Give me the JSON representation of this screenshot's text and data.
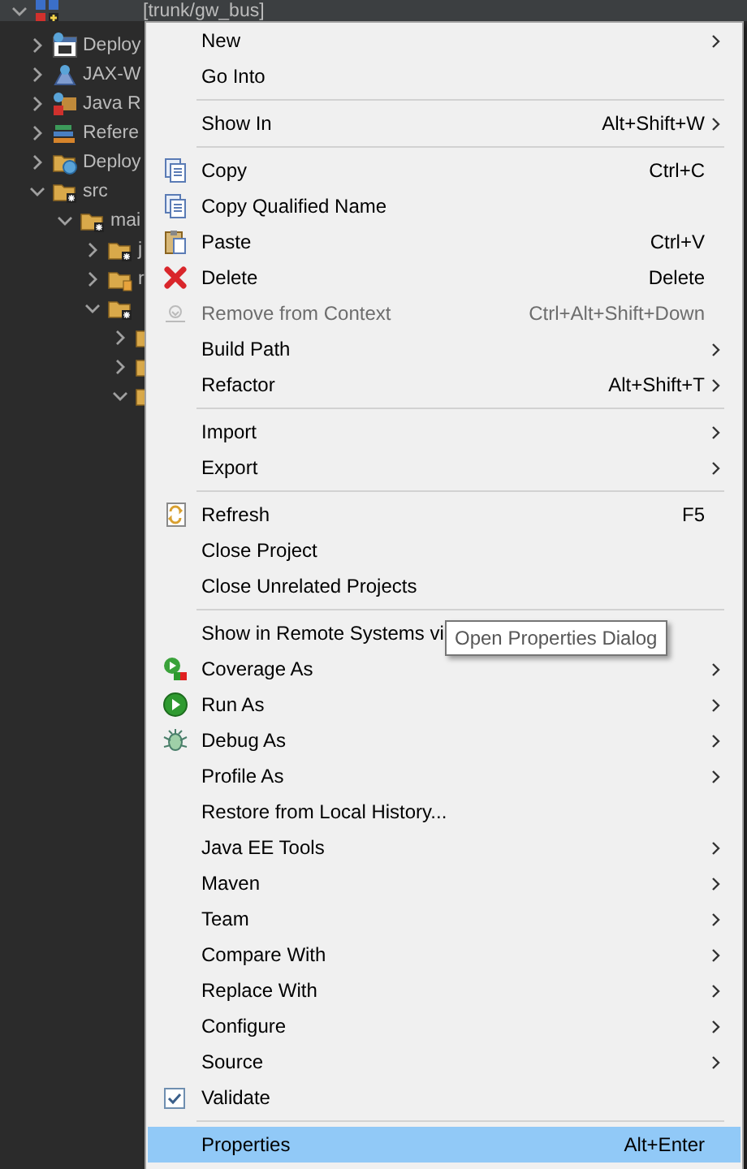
{
  "tree": {
    "items": [
      {
        "label": "[trunk/gw_bus]",
        "kind": "project",
        "expanded": true,
        "selected": true,
        "children": [
          {
            "label": "Deploy",
            "kind": "descriptor",
            "expanded": false,
            "selected": false
          },
          {
            "label": "JAX-W",
            "kind": "service",
            "expanded": false,
            "selected": false
          },
          {
            "label": "Java R",
            "kind": "resources",
            "expanded": false,
            "selected": false
          },
          {
            "label": "Refere",
            "kind": "library",
            "expanded": false,
            "selected": false
          },
          {
            "label": "Deploy",
            "kind": "deployed",
            "expanded": false,
            "selected": false
          },
          {
            "label": "src",
            "kind": "source-folder",
            "expanded": true,
            "selected": false,
            "children": [
              {
                "label": "mai",
                "kind": "source-folder",
                "expanded": true,
                "selected": false,
                "children": [
                  {
                    "label": "j",
                    "kind": "source-folder",
                    "expanded": false,
                    "selected": false
                  },
                  {
                    "label": "r",
                    "kind": "resource-folder",
                    "expanded": false,
                    "selected": false
                  },
                  {
                    "kind": "source-folder",
                    "expanded": true,
                    "selected": false,
                    "children": [
                      {
                        "kind": "folder",
                        "expanded": false,
                        "selected": false
                      },
                      {
                        "kind": "folder",
                        "expanded": false,
                        "selected": false
                      },
                      {
                        "kind": "folder",
                        "expanded": true,
                        "selected": false
                      }
                    ]
                  }
                ]
              }
            ]
          }
        ]
      }
    ]
  },
  "context_menu": {
    "items": [
      {
        "kind": "item",
        "label": "New",
        "submenu": true,
        "disabled": false,
        "selected": false
      },
      {
        "kind": "item",
        "label": "Go Into",
        "submenu": false,
        "disabled": false,
        "selected": false
      },
      {
        "kind": "separator"
      },
      {
        "kind": "item",
        "label": "Show In",
        "shortcut": "Alt+Shift+W",
        "submenu": true,
        "disabled": false,
        "selected": false
      },
      {
        "kind": "separator"
      },
      {
        "kind": "item",
        "label": "Copy",
        "shortcut": "Ctrl+C",
        "submenu": false,
        "disabled": false,
        "selected": false
      },
      {
        "kind": "item",
        "label": "Copy Qualified Name",
        "submenu": false,
        "disabled": false,
        "selected": false
      },
      {
        "kind": "item",
        "label": "Paste",
        "shortcut": "Ctrl+V",
        "submenu": false,
        "disabled": false,
        "selected": false
      },
      {
        "kind": "item",
        "label": "Delete",
        "shortcut": "Delete",
        "submenu": false,
        "disabled": false,
        "selected": false
      },
      {
        "kind": "item",
        "label": "Remove from Context",
        "shortcut": "Ctrl+Alt+Shift+Down",
        "submenu": false,
        "disabled": true,
        "selected": false
      },
      {
        "kind": "item",
        "label": "Build Path",
        "submenu": true,
        "disabled": false,
        "selected": false
      },
      {
        "kind": "item",
        "label": "Refactor",
        "shortcut": "Alt+Shift+T",
        "submenu": true,
        "disabled": false,
        "selected": false
      },
      {
        "kind": "separator"
      },
      {
        "kind": "item",
        "label": "Import",
        "submenu": true,
        "disabled": false,
        "selected": false
      },
      {
        "kind": "item",
        "label": "Export",
        "submenu": true,
        "disabled": false,
        "selected": false
      },
      {
        "kind": "separator"
      },
      {
        "kind": "item",
        "label": "Refresh",
        "shortcut": "F5",
        "submenu": false,
        "disabled": false,
        "selected": false
      },
      {
        "kind": "item",
        "label": "Close Project",
        "submenu": false,
        "disabled": false,
        "selected": false
      },
      {
        "kind": "item",
        "label": "Close Unrelated Projects",
        "submenu": false,
        "disabled": false,
        "selected": false
      },
      {
        "kind": "separator"
      },
      {
        "kind": "item",
        "label": "Show in Remote Systems vi",
        "submenu": false,
        "disabled": false,
        "selected": false
      },
      {
        "kind": "item",
        "label": "Coverage As",
        "submenu": true,
        "disabled": false,
        "selected": false
      },
      {
        "kind": "item",
        "label": "Run As",
        "submenu": true,
        "disabled": false,
        "selected": false
      },
      {
        "kind": "item",
        "label": "Debug As",
        "submenu": true,
        "disabled": false,
        "selected": false
      },
      {
        "kind": "item",
        "label": "Profile As",
        "submenu": true,
        "disabled": false,
        "selected": false
      },
      {
        "kind": "item",
        "label": "Restore from Local History...",
        "submenu": false,
        "disabled": false,
        "selected": false
      },
      {
        "kind": "item",
        "label": "Java EE Tools",
        "submenu": true,
        "disabled": false,
        "selected": false
      },
      {
        "kind": "item",
        "label": "Maven",
        "submenu": true,
        "disabled": false,
        "selected": false
      },
      {
        "kind": "item",
        "label": "Team",
        "submenu": true,
        "disabled": false,
        "selected": false
      },
      {
        "kind": "item",
        "label": "Compare With",
        "submenu": true,
        "disabled": false,
        "selected": false
      },
      {
        "kind": "item",
        "label": "Replace With",
        "submenu": true,
        "disabled": false,
        "selected": false
      },
      {
        "kind": "item",
        "label": "Configure",
        "submenu": true,
        "disabled": false,
        "selected": false
      },
      {
        "kind": "item",
        "label": "Source",
        "submenu": true,
        "disabled": false,
        "selected": false
      },
      {
        "kind": "check",
        "label": "Validate",
        "checked": true,
        "submenu": false,
        "disabled": false,
        "selected": false
      },
      {
        "kind": "separator"
      },
      {
        "kind": "item",
        "label": "Properties",
        "shortcut": "Alt+Enter",
        "submenu": false,
        "disabled": false,
        "selected": true
      }
    ]
  },
  "tooltip": {
    "text": "Open Properties Dialog"
  }
}
